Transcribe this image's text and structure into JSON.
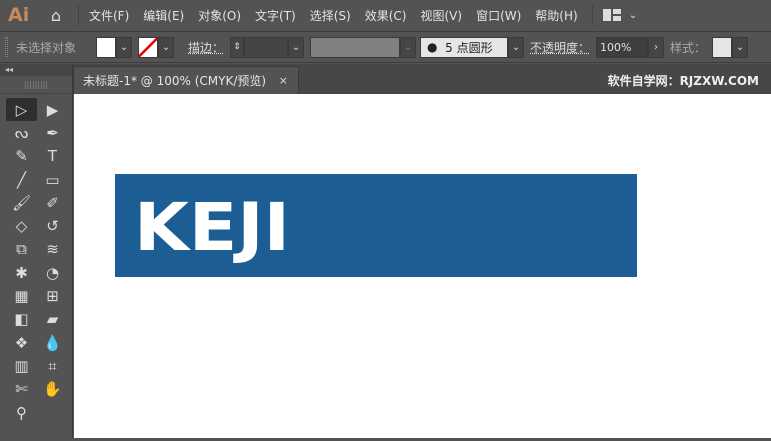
{
  "app": {
    "logo": "Ai",
    "menus": [
      "文件(F)",
      "编辑(E)",
      "对象(O)",
      "文字(T)",
      "选择(S)",
      "效果(C)",
      "视图(V)",
      "窗口(W)",
      "帮助(H)"
    ]
  },
  "control": {
    "selection": "未选择对象",
    "stroke_label": "描边：",
    "brush": "5 点圆形",
    "opacity_label": "不透明度：",
    "opacity": "100%",
    "style_label": "样式："
  },
  "tab": {
    "title": "未标题-1* @ 100% (CMYK/预览)",
    "close": "×"
  },
  "brand": "软件自学网：RJZXW.COM",
  "tools": [
    "selection",
    "direct-selection",
    "magic-wand",
    "pen",
    "curvature",
    "type",
    "line",
    "rectangle",
    "paintbrush",
    "shaper",
    "eraser",
    "rotate",
    "scale",
    "warp",
    "puppet-warp",
    "shape-builder",
    "perspective",
    "mesh",
    "gradient",
    "eyedropper-blend",
    "blend",
    "eyedropper",
    "graph",
    "artboard",
    "slice",
    "hand",
    "zoom"
  ],
  "artwork": {
    "text": "KEJI",
    "bg": "#1c5e93"
  }
}
